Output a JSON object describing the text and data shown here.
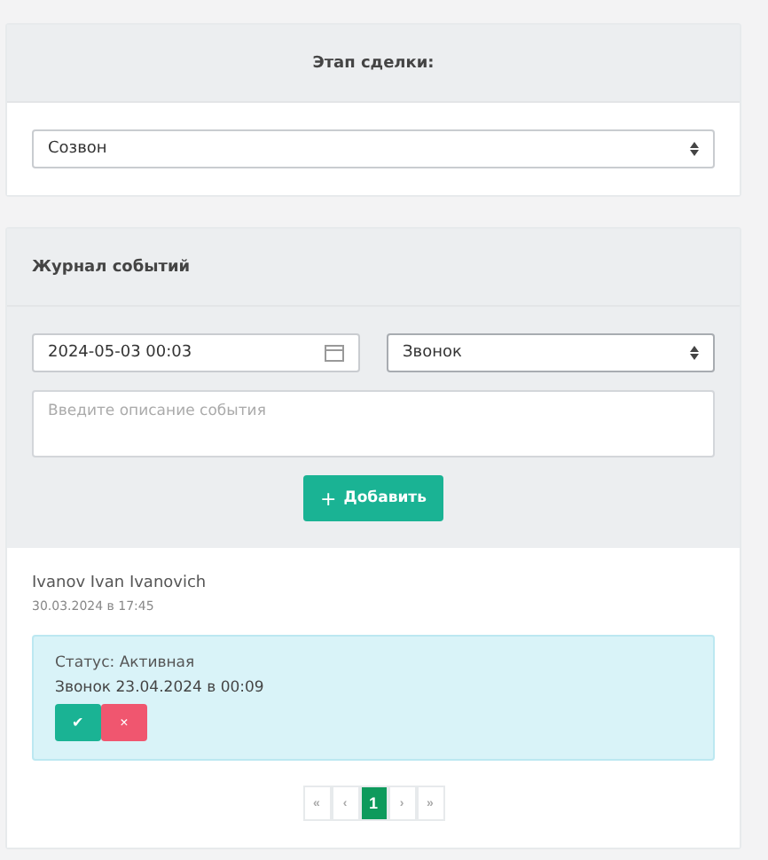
{
  "stage": {
    "title": "Этап сделки:",
    "value": "Созвон"
  },
  "journal": {
    "title": "Журнал событий",
    "date": "2024-05-03 00:03",
    "type": "Звонок",
    "description": {
      "placeholder": "Введите описание события"
    },
    "add_button": {
      "icon": "+",
      "label": "Добавить"
    },
    "author": "Ivanov Ivan Ivanovich",
    "created": "30.03.2024 в 17:45",
    "events": [
      {
        "status": "Статус: Активная",
        "text": "Звонок 23.04.2024 в 00:09",
        "confirm": "✔",
        "cancel": "×"
      }
    ],
    "pager": [
      {
        "label": "«",
        "selected": false
      },
      {
        "label": "‹",
        "selected": false
      },
      {
        "label": "1",
        "selected": true
      },
      {
        "label": "›",
        "selected": false
      },
      {
        "label": "»",
        "selected": false
      }
    ]
  }
}
